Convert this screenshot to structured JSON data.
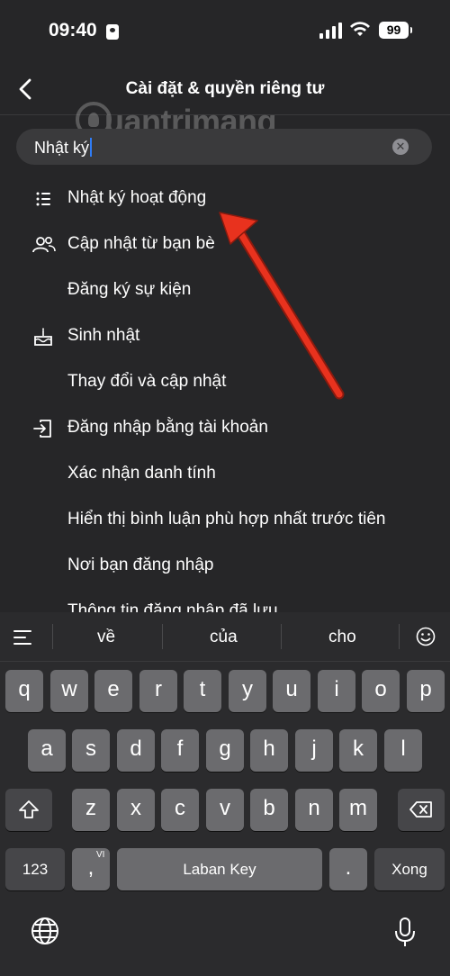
{
  "status_bar": {
    "time": "09:40",
    "battery": "99"
  },
  "header": {
    "title": "Cài đặt & quyền riêng tư"
  },
  "watermark": {
    "text": "uantrimang"
  },
  "search": {
    "value": "Nhật ký"
  },
  "results": [
    {
      "label": "Nhật ký hoạt động",
      "icon": "list-icon"
    },
    {
      "label": "Cập nhật từ bạn bè",
      "icon": "friends-icon"
    },
    {
      "label": "Đăng ký sự kiện",
      "icon": ""
    },
    {
      "label": "Sinh nhật",
      "icon": "birthday-cake-icon"
    },
    {
      "label": "Thay đổi và cập nhật",
      "icon": ""
    },
    {
      "label": "Đăng nhập bằng tài khoản",
      "icon": "login-icon"
    },
    {
      "label": "Xác nhận danh tính",
      "icon": ""
    },
    {
      "label": "Hiển thị bình luận phù hợp nhất trước tiên",
      "icon": ""
    },
    {
      "label": "Nơi bạn đăng nhập",
      "icon": ""
    },
    {
      "label": "Thông tin đăng nhập đã lưu",
      "icon": ""
    }
  ],
  "keyboard": {
    "suggestions": [
      "về",
      "của",
      "cho"
    ],
    "row1": [
      "q",
      "w",
      "e",
      "r",
      "t",
      "y",
      "u",
      "i",
      "o",
      "p"
    ],
    "row2": [
      "a",
      "s",
      "d",
      "f",
      "g",
      "h",
      "j",
      "k",
      "l"
    ],
    "row3": [
      "z",
      "x",
      "c",
      "v",
      "b",
      "n",
      "m"
    ],
    "numbers_key": "123",
    "comma_key": ",",
    "comma_alt": "VI",
    "space_key": "Laban Key",
    "period_key": ".",
    "return_key": "Xong"
  },
  "colors": {
    "background": "#262628",
    "arrow": "#e8321e",
    "caret": "#2f7cf6"
  }
}
